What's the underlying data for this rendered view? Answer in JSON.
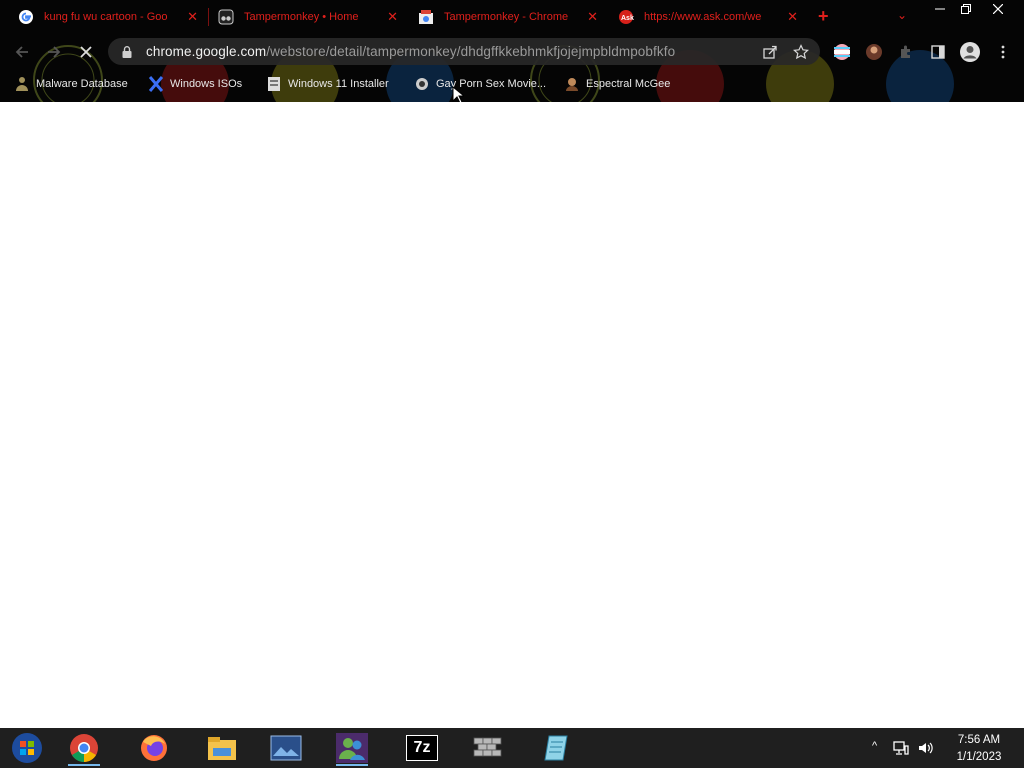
{
  "browser": {
    "tabs": [
      {
        "title": "kung fu wu cartoon - Goo",
        "favicon": "google-g-icon",
        "active": false
      },
      {
        "title": "Tampermonkey • Home",
        "favicon": "tampermonkey-icon",
        "active": false
      },
      {
        "title": "Tampermonkey - Chrome",
        "favicon": "chrome-web-store-icon",
        "active": true
      },
      {
        "title": "https://www.ask.com/we",
        "favicon": "ask-icon",
        "active": false
      }
    ],
    "new_tab_label": "+",
    "url_host": "chrome.google.com",
    "url_path": "/webstore/detail/tampermonkey/dhdgffkkebhmkfjojejmpbldmpobfkfo",
    "bookmarks": [
      {
        "label": "Malware Database",
        "icon": "malware-icon"
      },
      {
        "label": "Windows ISOs",
        "icon": "x-icon"
      },
      {
        "label": "Windows 11 Installer",
        "icon": "document-icon"
      },
      {
        "label": "Gay Porn Sex Movie...",
        "icon": "site-icon"
      },
      {
        "label": "Espectral McGee",
        "icon": "avatar-icon"
      }
    ],
    "colors": {
      "tab_text": "#e0201c",
      "accent": "#76b9ed"
    }
  },
  "taskbar": {
    "apps": [
      "start-icon",
      "chrome-icon",
      "firefox-icon",
      "file-explorer-icon",
      "photos-icon",
      "messenger-icon",
      "7zip-icon",
      "wall-icon",
      "notepad-icon"
    ],
    "sevenzip_label": "7z",
    "clock_time": "7:56 AM",
    "clock_date": "1/1/2023",
    "tray_chevron": "^"
  }
}
